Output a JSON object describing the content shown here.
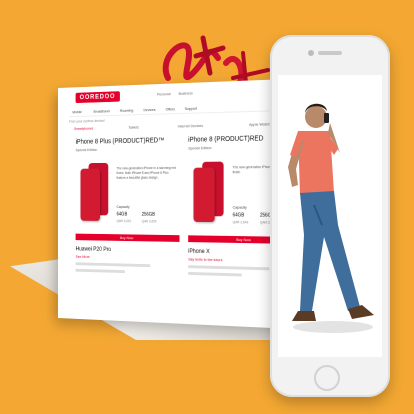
{
  "site": {
    "brand": "OOREDOO",
    "top_tabs": [
      "Personal",
      "Business"
    ],
    "nav": [
      "Mobile",
      "Broadband",
      "Roaming",
      "Devices",
      "Offers",
      "Support"
    ],
    "search_hint": "Find your perfect device!",
    "filters": [
      "Smartphones",
      "Tablets",
      "Internet Devices",
      "Apple Watch"
    ]
  },
  "products": [
    {
      "name": "iPhone 8 Plus (PRODUCT)RED™",
      "edition": "Special Edition",
      "description": "The new-generation iPhone in a stunning red finish. Both iPhone 8 and iPhone 8 Plus feature a beautiful glass design.",
      "capacity_label": "Capacity",
      "capacities": [
        "64GB",
        "256GB"
      ],
      "prices": [
        "QAR 3,029",
        "QAR 3,629"
      ],
      "buy_label": "Buy Now"
    },
    {
      "name": "iPhone 8 (PRODUCT)RED",
      "edition": "Special Edition",
      "description": "The new-generation iPhone in a stunning red finish.",
      "capacity_label": "Capacity",
      "capacities": [
        "64GB",
        "256GB"
      ],
      "prices": [
        "QAR 2,649",
        "QAR 3,249"
      ],
      "buy_label": "Buy Now"
    }
  ],
  "more_products": [
    {
      "name": "Huawei P20 Pro",
      "sub": "See More"
    },
    {
      "name": "iPhone X",
      "sub": "Say hello to the future"
    }
  ],
  "colors": {
    "background": "#f4a833",
    "brand_red": "#e4002b",
    "phone_body": "#f2f2f2"
  }
}
